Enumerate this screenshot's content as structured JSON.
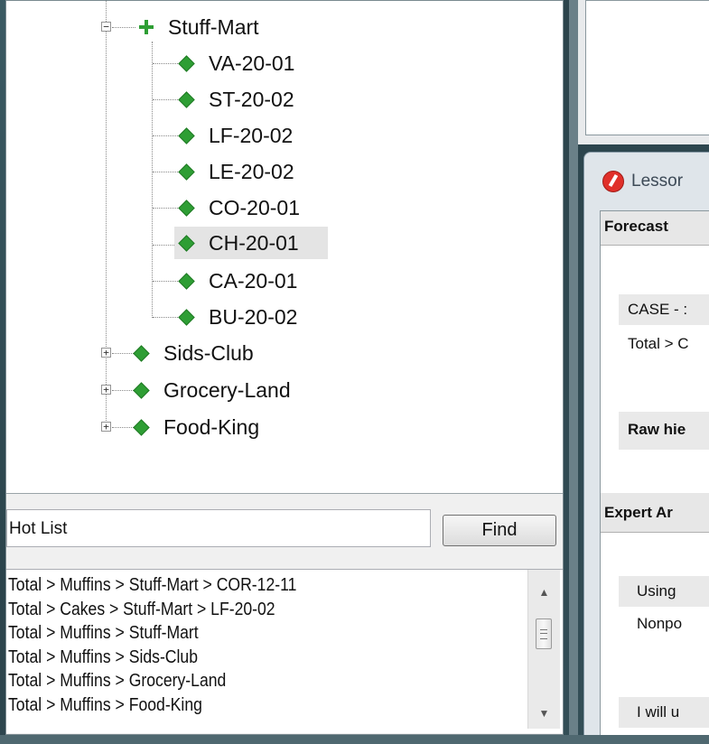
{
  "tree": {
    "parent": {
      "label": "Stuff-Mart",
      "expander": "−"
    },
    "children": [
      {
        "label": "VA-20-01"
      },
      {
        "label": "ST-20-02"
      },
      {
        "label": "LF-20-02"
      },
      {
        "label": "LE-20-02"
      },
      {
        "label": "CO-20-01"
      },
      {
        "label": "CH-20-01",
        "selected": true
      },
      {
        "label": "CA-20-01"
      },
      {
        "label": "BU-20-02"
      }
    ],
    "siblings": [
      {
        "label": "Sids-Club",
        "expander": "+"
      },
      {
        "label": "Grocery-Land",
        "expander": "+"
      },
      {
        "label": "Food-King",
        "expander": "+"
      }
    ]
  },
  "hotlist": {
    "input_value": "Hot List",
    "find_label": "Find",
    "items": [
      "Total > Muffins > Stuff-Mart > COR-12-11",
      "Total > Cakes > Stuff-Mart > LF-20-02",
      "Total > Muffins > Stuff-Mart",
      "Total > Muffins > Sids-Club",
      "Total > Muffins > Grocery-Land",
      "Total > Muffins > Food-King"
    ]
  },
  "lesson": {
    "title": "Lessor",
    "forecast_header": "Forecast",
    "case_row": "CASE - :",
    "total_row": "Total > C",
    "raw_row": "Raw hie",
    "expert_header": "Expert Ar",
    "using_row": "Using",
    "nonpo_row": "Nonpo",
    "will_row": "I will u"
  },
  "colors": {
    "tree_icon": "#2e9e34",
    "lesson_icon": "#e0302a"
  }
}
